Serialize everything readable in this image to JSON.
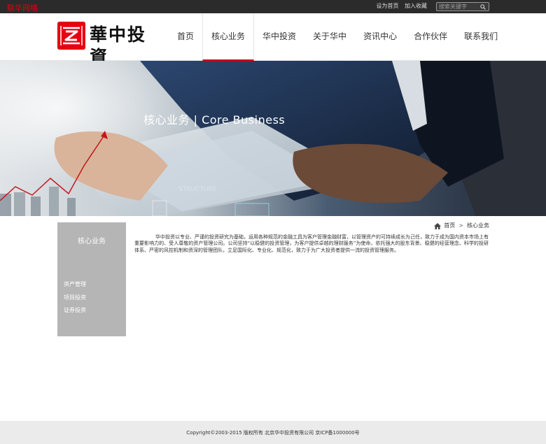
{
  "topbar": {
    "corner_label": "联华网络",
    "links": [
      "设为首页",
      "加入收藏"
    ],
    "search_placeholder": "搜索关键字"
  },
  "header": {
    "logo_name": "華中投資",
    "nav": [
      {
        "label": "首页",
        "active": false
      },
      {
        "label": "核心业务",
        "active": true
      },
      {
        "label": "华中投资",
        "active": false
      },
      {
        "label": "关于华中",
        "active": false
      },
      {
        "label": "资讯中心",
        "active": false
      },
      {
        "label": "合作伙伴",
        "active": false
      },
      {
        "label": "联系我们",
        "active": false
      }
    ]
  },
  "banner": {
    "title": "核心业务 | Core Business",
    "graphic_text": "STRUCTURE"
  },
  "sidebar": {
    "title": "核心业务",
    "items": [
      "资产管理",
      "项目投资",
      "证券投资"
    ]
  },
  "breadcrumb": {
    "home": "首页",
    "separator": ">",
    "current": "核心业务"
  },
  "content": {
    "paragraph": "华中投资以专业、严谨的投资研究为基础，运用各种规范的金融工具为客户管理金融财富，以管理资产的可持续成长为己任，致力于成为国内资本市场上有重要影响力的、受人尊敬的资产管理公司。公司坚持“以稳健的投资管理，为客户提供卓越的理财服务”为使命，依托强大的股东背景、稳健的经营理念、科学的投研体系、严密的风控机制和资深的管理团队，立足国际化、专业化、规范化，致力于为广大投资者提供一流的投资管理服务。"
  },
  "footer": {
    "copyright": "Copyright©2003-2015 版权所有 北京华中投资有限公司 京ICP备1000000号"
  },
  "colors": {
    "brand_red": "#e60012",
    "topbar_bg": "#2b2b2b",
    "sidebar_bg": "#b5b5b5",
    "footer_bg": "#ebebeb"
  }
}
